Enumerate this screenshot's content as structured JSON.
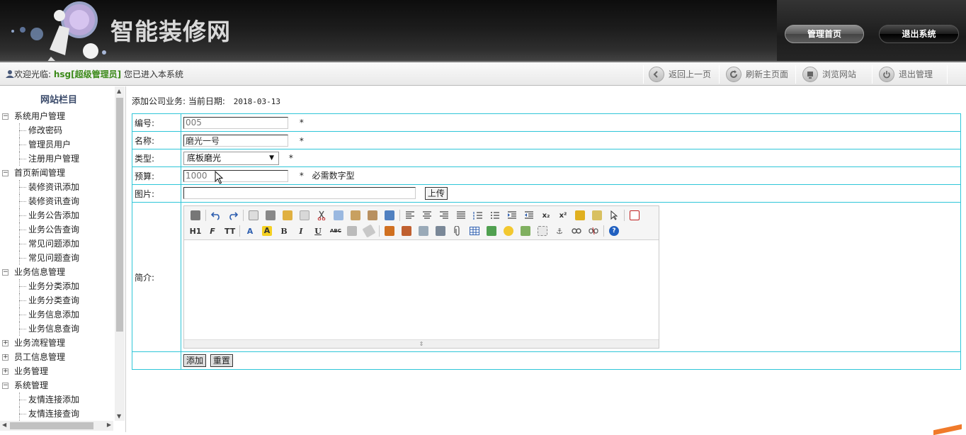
{
  "header": {
    "site_title": "智能装修网",
    "buttons": {
      "admin_home": "管理首页",
      "exit_system": "退出系统"
    }
  },
  "toolbar": {
    "welcome_prefix": "欢迎光临:",
    "welcome_user": "hsg[超级管理员]",
    "welcome_suffix": "您已进入本系统",
    "items": [
      {
        "label": "返回上一页",
        "icon": "back-icon"
      },
      {
        "label": "刷新主页面",
        "icon": "refresh-icon"
      },
      {
        "label": "浏览网站",
        "icon": "browse-icon"
      },
      {
        "label": "退出管理",
        "icon": "power-icon"
      }
    ]
  },
  "sidebar": {
    "title": "网站栏目",
    "groups": [
      {
        "label": "系统用户管理",
        "toggle": "−",
        "items": [
          "修改密码",
          "管理员用户",
          "注册用户管理"
        ]
      },
      {
        "label": "首页新闻管理",
        "toggle": "−",
        "items": [
          "装修资讯添加",
          "装修资讯查询",
          "业务公告添加",
          "业务公告查询",
          "常见问题添加",
          "常见问题查询"
        ]
      },
      {
        "label": "业务信息管理",
        "toggle": "−",
        "items": [
          "业务分类添加",
          "业务分类查询",
          "业务信息添加",
          "业务信息查询"
        ]
      },
      {
        "label": "业务流程管理",
        "toggle": "+",
        "items": []
      },
      {
        "label": "员工信息管理",
        "toggle": "+",
        "items": []
      },
      {
        "label": "业务管理",
        "toggle": "+",
        "items": []
      },
      {
        "label": "系统管理",
        "toggle": "−",
        "items": [
          "友情连接添加",
          "友情连接查询"
        ]
      }
    ]
  },
  "main": {
    "heading": "添加公司业务:  当前日期:",
    "date": "2018-03-13",
    "form": {
      "number_label": "编号:",
      "number_value": "005",
      "name_label": "名称:",
      "name_value": "磨光一号",
      "type_label": "类型:",
      "type_selected": "底板磨光",
      "budget_label": "预算:",
      "budget_value": "1000",
      "budget_hint": "必需数字型",
      "image_label": "图片:",
      "image_value": "",
      "upload_button": "上传",
      "intro_label": "简介:",
      "editor_heading_btn": "H1",
      "submit_button": "添加",
      "reset_button": "重置",
      "required_mark": "*"
    }
  }
}
